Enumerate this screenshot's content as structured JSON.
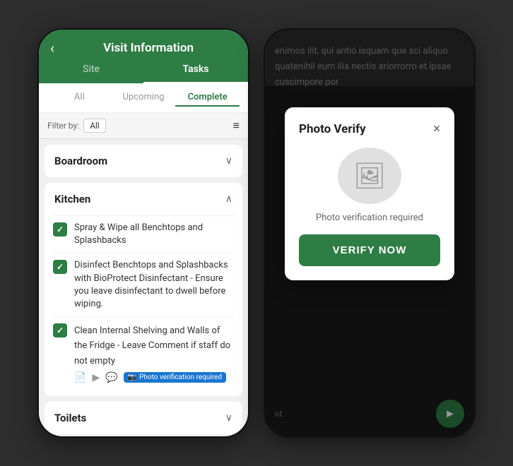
{
  "header": {
    "back_label": "‹",
    "title": "Visit Information"
  },
  "tabs_primary": [
    {
      "id": "site",
      "label": "Site",
      "active": false
    },
    {
      "id": "tasks",
      "label": "Tasks",
      "active": true
    }
  ],
  "tabs_secondary": [
    {
      "id": "all",
      "label": "All",
      "active": false
    },
    {
      "id": "upcoming",
      "label": "Upcoming",
      "active": false
    },
    {
      "id": "complete",
      "label": "Complete",
      "active": true
    }
  ],
  "filter": {
    "label": "Filter by:",
    "value": "All",
    "icon": "≡"
  },
  "sections": [
    {
      "id": "boardroom",
      "title": "Boardroom",
      "expanded": false,
      "tasks": []
    },
    {
      "id": "kitchen",
      "title": "Kitchen",
      "expanded": true,
      "tasks": [
        {
          "id": "task1",
          "text": "Spray & Wipe all Benchtops and Splashbacks",
          "checked": true,
          "icons": []
        },
        {
          "id": "task2",
          "text": "Disinfect Benchtops and Splashbacks with BioProtect Disinfectant - Ensure you leave disinfectant to dwell before wiping.",
          "checked": true,
          "icons": []
        },
        {
          "id": "task3",
          "text": "Clean Internal Shelving and Walls of the Fridge - Leave Comment if staff do not empty",
          "checked": true,
          "icons": [
            "doc",
            "play",
            "comment"
          ],
          "photo_verify": true,
          "photo_verify_label": "Photo verification required"
        }
      ]
    },
    {
      "id": "toilets",
      "title": "Toilets",
      "expanded": false,
      "tasks": []
    }
  ],
  "photo_verify_modal": {
    "title": "Photo Verify",
    "close_label": "×",
    "description": "Photo verification required",
    "verify_button_label": "VERIFY NOW"
  },
  "right_bg_text": "enimos ilit, qui antio isquam que sci aliquo quatenihil eum ilia nectis ariorrorro et ipsae cuscimpore por",
  "bottom_placeholder": "nt"
}
